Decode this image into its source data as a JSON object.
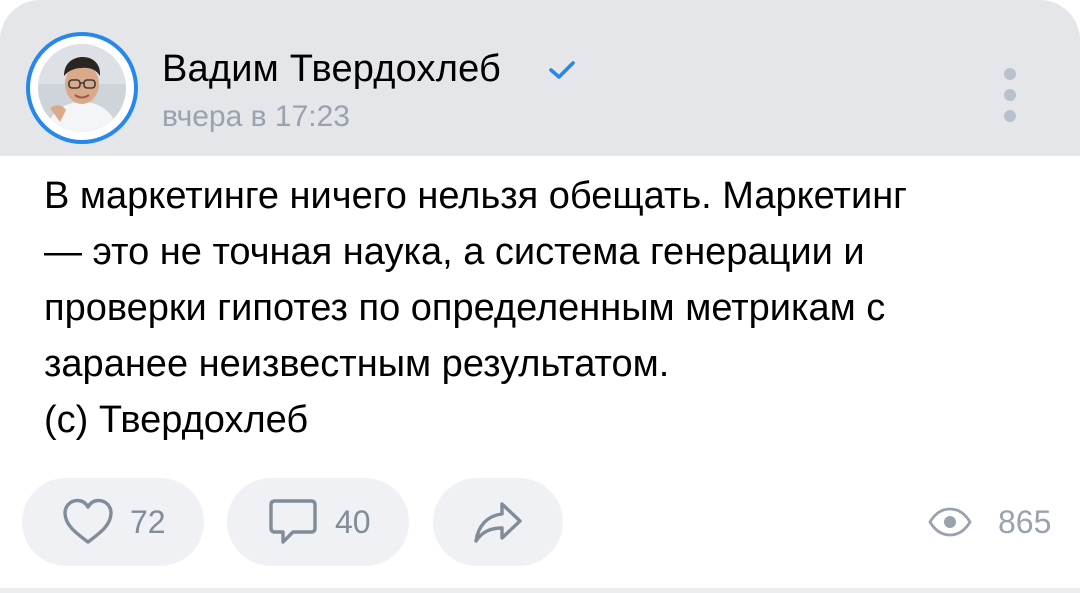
{
  "post": {
    "author": {
      "name": "Вадим Твердохлеб",
      "verified": true,
      "avatar": "author-photo"
    },
    "time": "вчера в 17:23",
    "text_lines": [
      "В маркетинге ничего нельзя обещать. Маркетинг",
      "— это не точная наука, а система генерации и",
      "проверки гипотез по определенным метрикам с",
      "заранее неизвестным результатом.",
      "(с) Твердохлеб"
    ],
    "actions": {
      "likes": "72",
      "comments": "40",
      "share_icon": "share-arrow-icon"
    },
    "views": "865"
  },
  "colors": {
    "accent": "#2688eb",
    "header_bg": "#e4e6ea",
    "secondary_text": "#99a2ad",
    "icon": "#818c99"
  }
}
